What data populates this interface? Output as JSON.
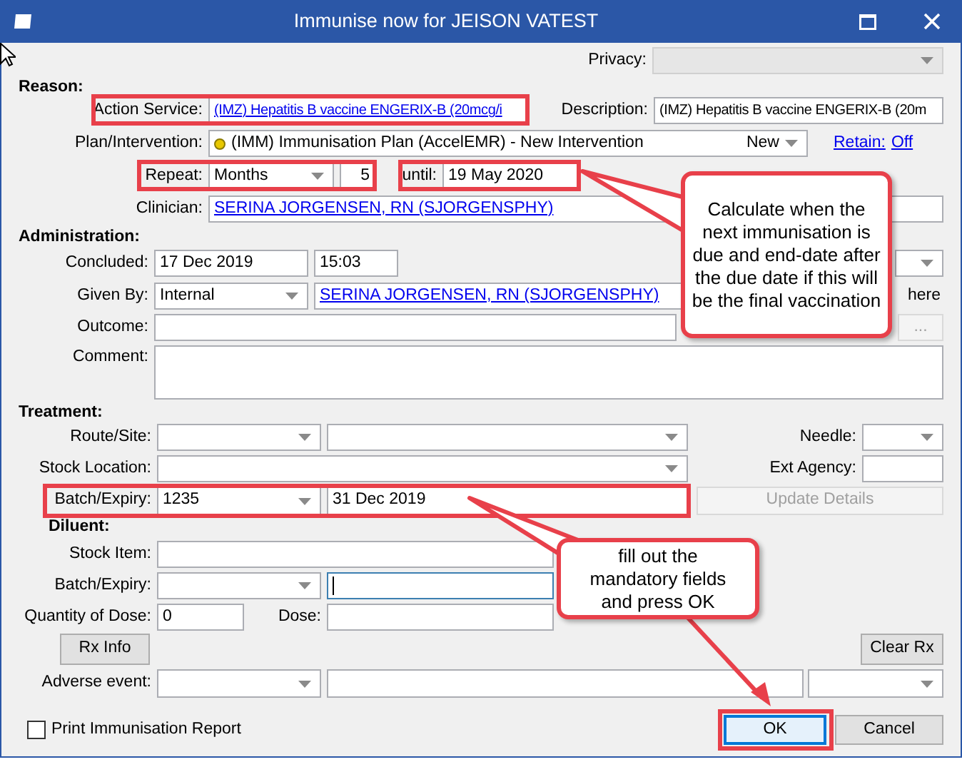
{
  "window": {
    "title": "Immunise now for JEISON VATEST"
  },
  "privacy": {
    "label": "Privacy:",
    "disabled": true
  },
  "reason": {
    "heading": "Reason:",
    "action_service": {
      "label": "Action Service:",
      "value": "(IMZ) Hepatitis B vaccine ENGERIX-B (20mcg/i"
    },
    "description": {
      "label": "Description:",
      "value": "(IMZ) Hepatitis B vaccine ENGERIX-B (20m"
    },
    "plan": {
      "label": "Plan/Intervention:",
      "value": "(IMM) Immunisation Plan (AccelEMR) - New Intervention",
      "status": "New"
    },
    "retain": {
      "label": "Retain:",
      "value": "Off"
    },
    "repeat": {
      "label": "Repeat:",
      "unit": "Months",
      "count": "5"
    },
    "until": {
      "label": "until:",
      "value": "19 May 2020"
    },
    "clinician": {
      "label": "Clinician:",
      "value": "SERINA JORGENSEN, RN (SJORGENSPHY)"
    }
  },
  "administration": {
    "heading": "Administration:",
    "concluded": {
      "label": "Concluded:",
      "date": "17 Dec 2019",
      "time": "15:03"
    },
    "given_by": {
      "label": "Given By:",
      "value": "Internal",
      "clinician": "SERINA JORGENSEN, RN (SJORGENSPHY)",
      "note": "here"
    },
    "outcome": {
      "label": "Outcome:",
      "button": "...",
      "button_disabled": true
    },
    "comment": {
      "label": "Comment:"
    }
  },
  "treatment": {
    "heading": "Treatment:",
    "route_site": {
      "label": "Route/Site:"
    },
    "needle": {
      "label": "Needle:"
    },
    "stock_location": {
      "label": "Stock Location:"
    },
    "ext_agency": {
      "label": "Ext Agency:"
    },
    "batch_expiry": {
      "label": "Batch/Expiry:",
      "batch": "1235",
      "expiry": "31 Dec 2019"
    },
    "update_button": {
      "label": "Update Details",
      "disabled": true
    }
  },
  "diluent": {
    "heading": "Diluent:",
    "stock_item": {
      "label": "Stock Item:"
    },
    "batch_expiry": {
      "label": "Batch/Expiry:"
    },
    "quantity": {
      "label": "Quantity of Dose:",
      "value": "0"
    },
    "dose": {
      "label": "Dose:"
    }
  },
  "buttons": {
    "rx_info": "Rx Info",
    "clear_rx": "Clear Rx"
  },
  "adverse_event": {
    "label": "Adverse event:"
  },
  "print_report": {
    "label": "Print Immunisation Report",
    "checked": false
  },
  "footer_buttons": [
    {
      "label": "OK",
      "default": true
    },
    {
      "label": "Cancel",
      "default": false
    }
  ],
  "callouts": [
    {
      "text": "Calculate when the next immunisation is due and end-date after the due date if this will be the final vaccination"
    },
    {
      "text": "fill out the mandatory fields and press OK"
    }
  ]
}
